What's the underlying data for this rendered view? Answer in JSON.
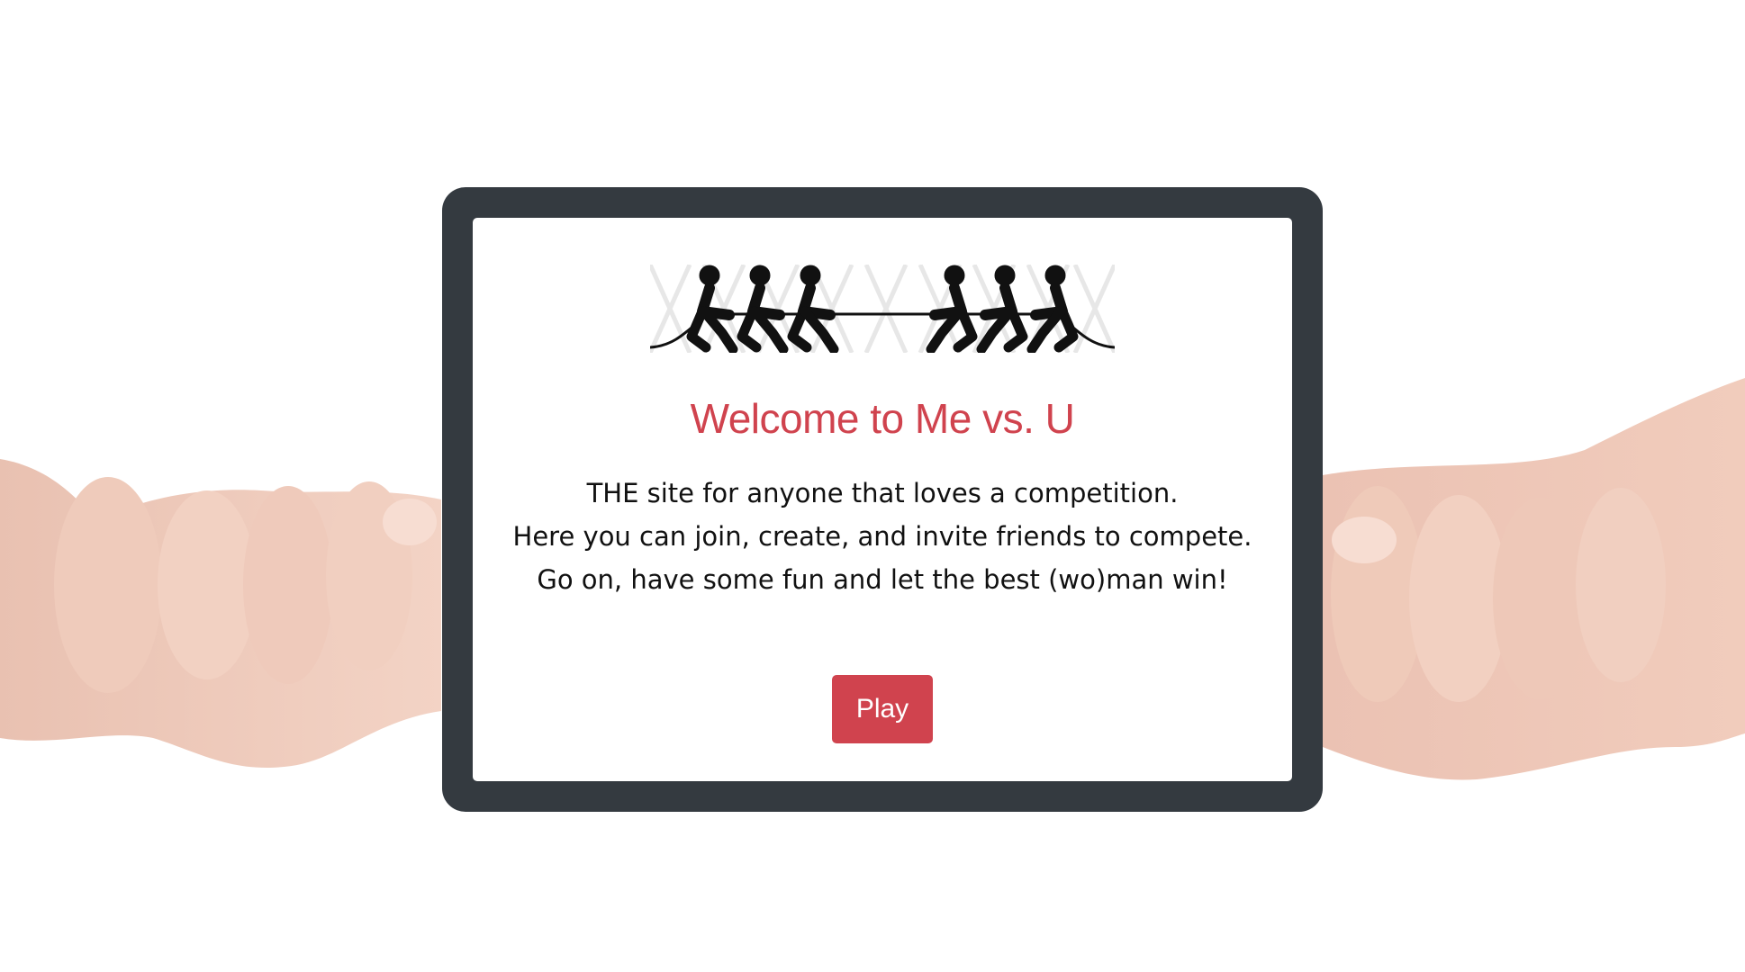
{
  "welcome": {
    "title": "Welcome to Me vs. U",
    "lines": [
      "THE site for anyone that loves a competition.",
      "Here you can join, create, and invite friends to compete.",
      "Go on, have some fun and let the best (wo)man win!"
    ],
    "play_label": "Play"
  },
  "colors": {
    "accent": "#d0434e",
    "frame": "#343a40",
    "card": "#ffffff"
  },
  "icons": {
    "logo": "tug-of-war-icon",
    "background": "hands-pulling-rope-illustration"
  }
}
